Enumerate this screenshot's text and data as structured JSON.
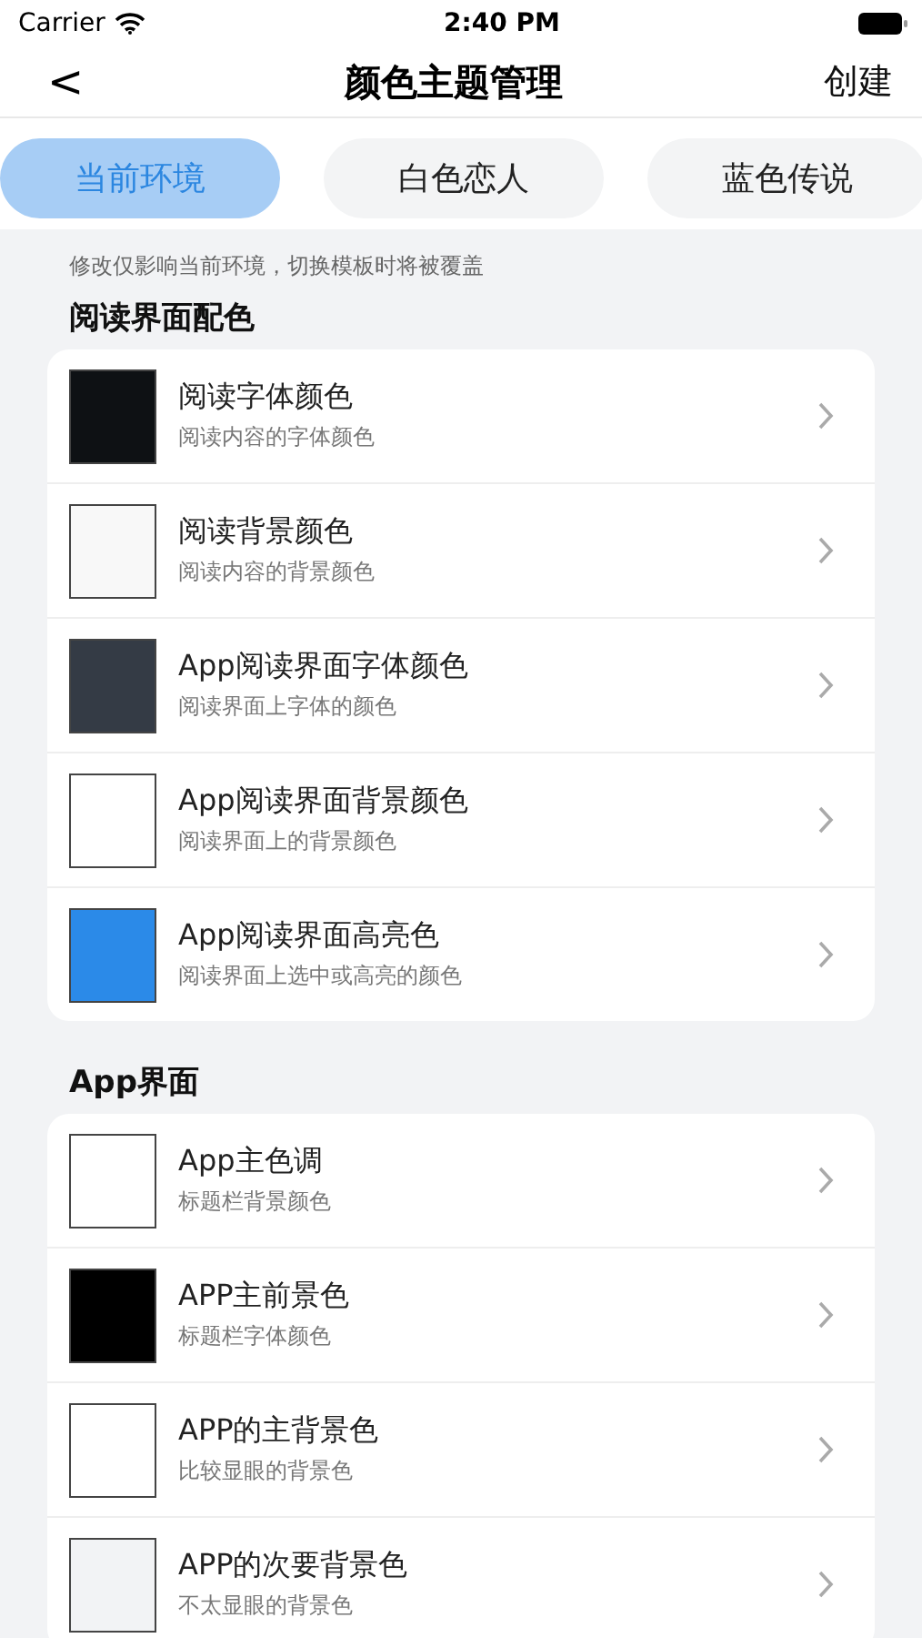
{
  "status_bar": {
    "carrier": "Carrier",
    "time": "2:40 PM"
  },
  "nav": {
    "back": "<",
    "title": "颜色主题管理",
    "action": "创建"
  },
  "tabs": [
    {
      "label": "当前环境",
      "selected": true
    },
    {
      "label": "白色恋人",
      "selected": false
    },
    {
      "label": "蓝色传说",
      "selected": false
    }
  ],
  "note": "修改仅影响当前环境，切换模板时将被覆盖",
  "sections": [
    {
      "title": "阅读界面配色",
      "items": [
        {
          "title": "阅读字体颜色",
          "subtitle": "阅读内容的字体颜色",
          "color": "#0e1114"
        },
        {
          "title": "阅读背景颜色",
          "subtitle": "阅读内容的背景颜色",
          "color": "#f8f8f8"
        },
        {
          "title": "App阅读界面字体颜色",
          "subtitle": "阅读界面上字体的颜色",
          "color": "#343b45"
        },
        {
          "title": "App阅读界面背景颜色",
          "subtitle": "阅读界面上的背景颜色",
          "color": "#ffffff"
        },
        {
          "title": "App阅读界面高亮色",
          "subtitle": "阅读界面上选中或高亮的颜色",
          "color": "#2b8ae8"
        }
      ]
    },
    {
      "title": "App界面",
      "items": [
        {
          "title": "App主色调",
          "subtitle": "标题栏背景颜色",
          "color": "#ffffff"
        },
        {
          "title": "APP主前景色",
          "subtitle": "标题栏字体颜色",
          "color": "#000000"
        },
        {
          "title": "APP的主背景色",
          "subtitle": "比较显眼的背景色",
          "color": "#ffffff"
        },
        {
          "title": "APP的次要背景色",
          "subtitle": "不太显眼的背景色",
          "color": "#f2f3f5"
        }
      ]
    }
  ]
}
